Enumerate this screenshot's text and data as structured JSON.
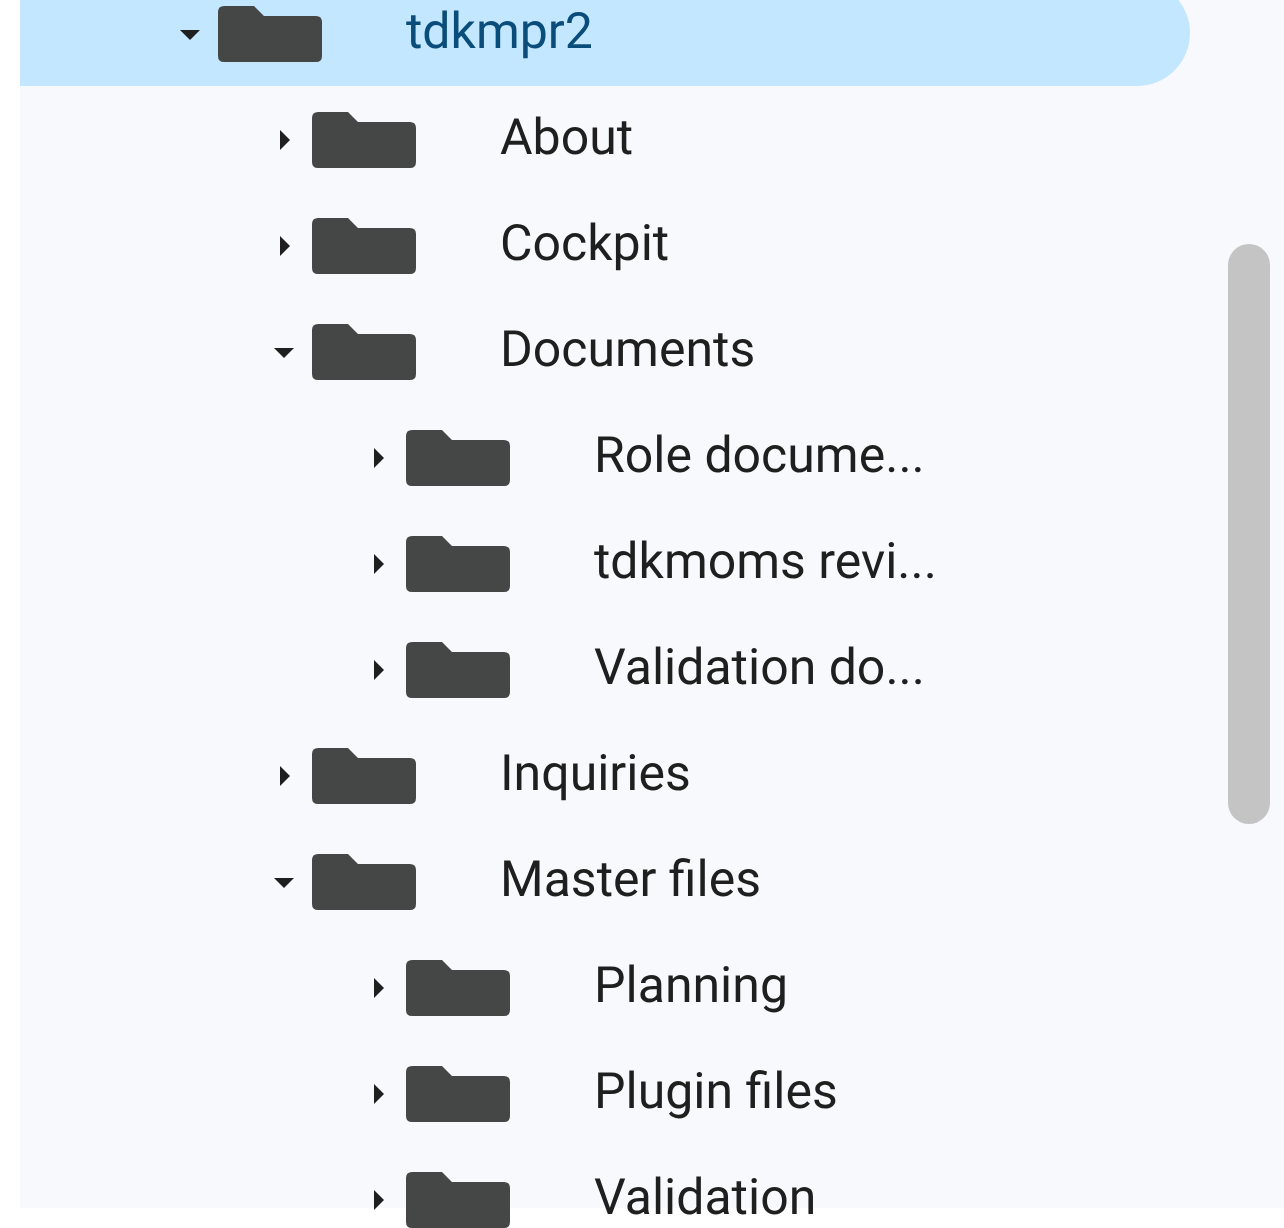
{
  "tree": [
    {
      "label": "tdkmpr2",
      "expanded": true,
      "selected": true,
      "children": [
        {
          "label": "About",
          "expanded": false,
          "selected": false
        },
        {
          "label": "Cockpit",
          "expanded": false,
          "selected": false
        },
        {
          "label": "Documents",
          "expanded": true,
          "selected": false,
          "children": [
            {
              "label": "Role docume...",
              "expanded": false,
              "selected": false
            },
            {
              "label": "tdkmoms revi...",
              "expanded": false,
              "selected": false
            },
            {
              "label": "Validation do...",
              "expanded": false,
              "selected": false
            }
          ]
        },
        {
          "label": "Inquiries",
          "expanded": false,
          "selected": false
        },
        {
          "label": "Master files",
          "expanded": true,
          "selected": false,
          "children": [
            {
              "label": "Planning",
              "expanded": false,
              "selected": false
            },
            {
              "label": "Plugin files",
              "expanded": false,
              "selected": false
            },
            {
              "label": "Validation",
              "expanded": false,
              "selected": false
            }
          ]
        }
      ]
    }
  ]
}
